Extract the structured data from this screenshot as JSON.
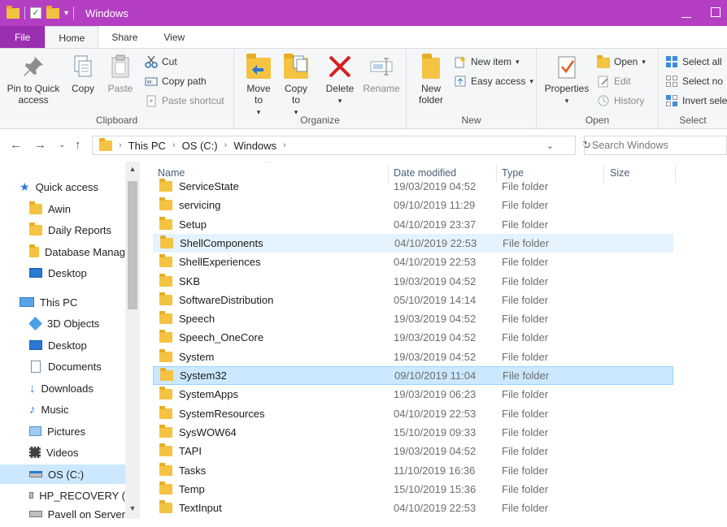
{
  "window": {
    "title": "Windows"
  },
  "tabs": [
    {
      "label": "File"
    },
    {
      "label": "Home"
    },
    {
      "label": "Share"
    },
    {
      "label": "View"
    }
  ],
  "ribbon": {
    "clipboard": {
      "label": "Clipboard",
      "pin": "Pin to Quick access",
      "copy": "Copy",
      "paste": "Paste",
      "cut": "Cut",
      "copy_path": "Copy path",
      "paste_shortcut": "Paste shortcut"
    },
    "organize": {
      "label": "Organize",
      "move_to": "Move to",
      "copy_to": "Copy to",
      "delete": "Delete",
      "rename": "Rename"
    },
    "new": {
      "label": "New",
      "new_folder": "New folder",
      "new_item": "New item",
      "easy_access": "Easy access"
    },
    "open": {
      "label": "Open",
      "properties": "Properties",
      "open": "Open",
      "edit": "Edit",
      "history": "History"
    },
    "select": {
      "label": "Select",
      "select_all": "Select all",
      "select_none": "Select no",
      "invert": "Invert sele"
    }
  },
  "address": {
    "crumbs": [
      "This PC",
      "OS (C:)",
      "Windows"
    ],
    "search_placeholder": "Search Windows"
  },
  "nav": {
    "quick_access": "Quick access",
    "items_qa": [
      "Awin",
      "Daily Reports",
      "Database Manag",
      "Desktop"
    ],
    "this_pc": "This PC",
    "items_pc": [
      "3D Objects",
      "Desktop",
      "Documents",
      "Downloads",
      "Music",
      "Pictures",
      "Videos",
      "OS (C:)",
      "HP_RECOVERY (",
      "Pavell on Server"
    ]
  },
  "columns": {
    "name": "Name",
    "date": "Date modified",
    "type": "Type",
    "size": "Size"
  },
  "files": [
    {
      "name": "ServiceState",
      "date": "19/03/2019 04:52",
      "type": "File folder"
    },
    {
      "name": "servicing",
      "date": "09/10/2019 11:29",
      "type": "File folder"
    },
    {
      "name": "Setup",
      "date": "04/10/2019 23:37",
      "type": "File folder"
    },
    {
      "name": "ShellComponents",
      "date": "04/10/2019 22:53",
      "type": "File folder"
    },
    {
      "name": "ShellExperiences",
      "date": "04/10/2019 22:53",
      "type": "File folder"
    },
    {
      "name": "SKB",
      "date": "19/03/2019 04:52",
      "type": "File folder"
    },
    {
      "name": "SoftwareDistribution",
      "date": "05/10/2019 14:14",
      "type": "File folder"
    },
    {
      "name": "Speech",
      "date": "19/03/2019 04:52",
      "type": "File folder"
    },
    {
      "name": "Speech_OneCore",
      "date": "19/03/2019 04:52",
      "type": "File folder"
    },
    {
      "name": "System",
      "date": "19/03/2019 04:52",
      "type": "File folder"
    },
    {
      "name": "System32",
      "date": "09/10/2019 11:04",
      "type": "File folder"
    },
    {
      "name": "SystemApps",
      "date": "19/03/2019 06:23",
      "type": "File folder"
    },
    {
      "name": "SystemResources",
      "date": "04/10/2019 22:53",
      "type": "File folder"
    },
    {
      "name": "SysWOW64",
      "date": "15/10/2019 09:33",
      "type": "File folder"
    },
    {
      "name": "TAPI",
      "date": "19/03/2019 04:52",
      "type": "File folder"
    },
    {
      "name": "Tasks",
      "date": "11/10/2019 16:36",
      "type": "File folder"
    },
    {
      "name": "Temp",
      "date": "15/10/2019 15:36",
      "type": "File folder"
    },
    {
      "name": "TextInput",
      "date": "04/10/2019 22:53",
      "type": "File folder"
    }
  ],
  "colors": {
    "titlebar": "#b43fc3",
    "file_tab": "#9a2fb0",
    "selection": "#cce8ff",
    "folder": "#f5c342"
  }
}
